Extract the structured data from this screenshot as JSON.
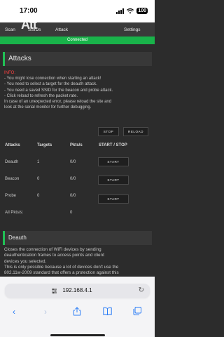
{
  "status_bar": {
    "time": "17:00",
    "battery": "100"
  },
  "nav": {
    "logo": "Att",
    "items": [
      "Scan",
      "SSIDs",
      "Attack",
      "Settings"
    ]
  },
  "banner": {
    "text": "Connected"
  },
  "attacks_card": {
    "title": "Attacks",
    "info_title": "INFO:",
    "info_lines": [
      "- You might lose connection when starting an attack!",
      "- You need to select a target for the deauth attack.",
      "- You need a saved SSID for the beacon and probe attack.",
      "- Click reload to refresh the packet rate.",
      "In case of an unexpected error, please reload the site and",
      "look at the serial monitor for further debugging."
    ],
    "stop_label": "STOP",
    "reload_label": "RELOAD"
  },
  "table": {
    "headers": [
      "Attacks",
      "Targets",
      "Pkts/s",
      "START / STOP"
    ],
    "rows": [
      {
        "attack": "Deauth",
        "targets": "1",
        "pkts": "0/0",
        "action": "START"
      },
      {
        "attack": "Beacon",
        "targets": "0",
        "pkts": "0/0",
        "action": "START"
      },
      {
        "attack": "Probe",
        "targets": "0",
        "pkts": "0/0",
        "action": "START"
      }
    ],
    "all_pkts_label": "All Pkts/s:",
    "all_pkts_value": "0"
  },
  "deauth_card": {
    "title": "Deauth",
    "desc_lines": [
      "Closes the connection of WiFi devices by sending",
      "deauthentication frames to access points and client",
      "devices you selected.",
      "This is only possible because a lot of devices don't use the",
      "802.11w-2009 standard that offers a protection against this"
    ]
  },
  "browser": {
    "url": "192.168.4.1",
    "icons": [
      "back-icon",
      "forward-icon",
      "share-icon",
      "bookmarks-icon",
      "tabs-icon"
    ]
  }
}
